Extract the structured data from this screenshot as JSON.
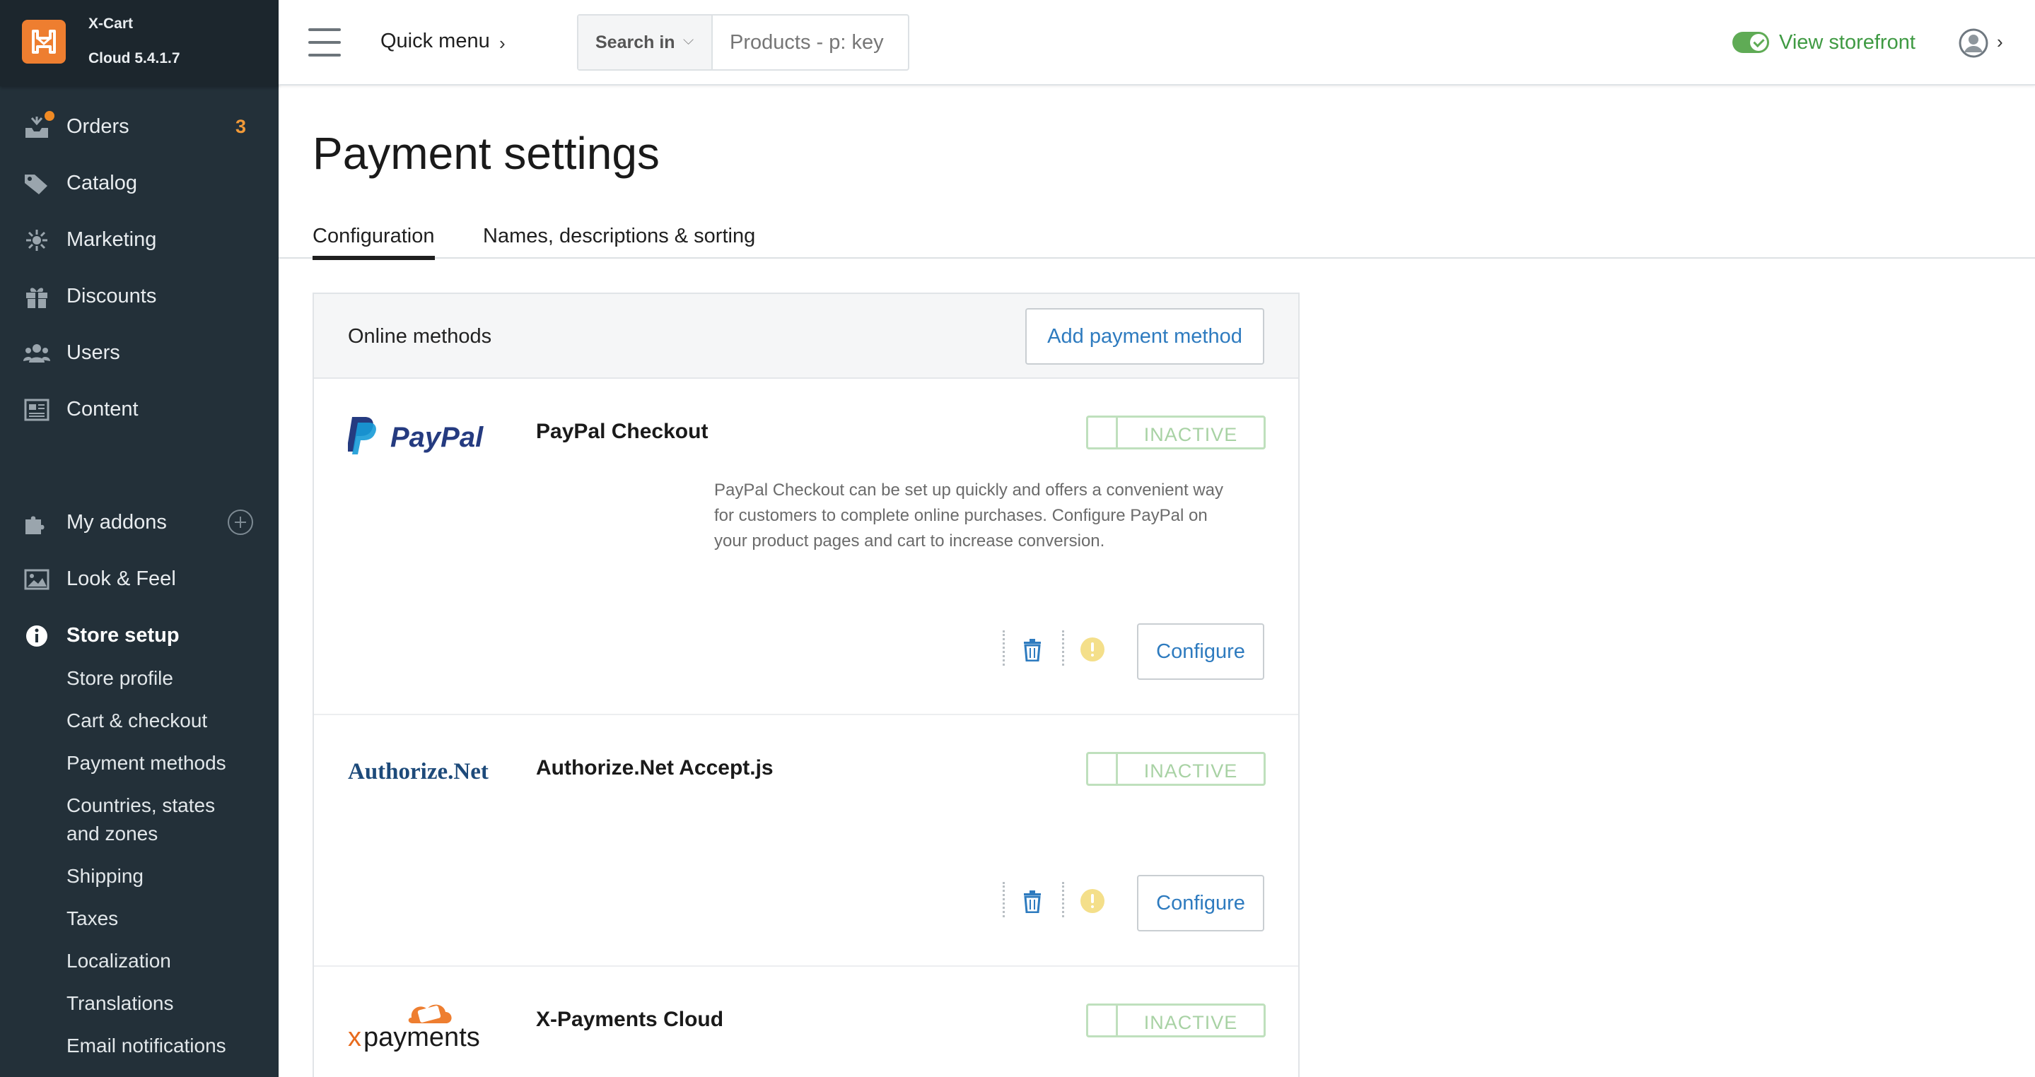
{
  "brand": {
    "name": "X-Cart",
    "version": "Cloud 5.4.1.7"
  },
  "sidebar": {
    "items": [
      {
        "label": "Orders",
        "icon": "orders-icon",
        "badge": "3"
      },
      {
        "label": "Catalog",
        "icon": "tag-icon"
      },
      {
        "label": "Marketing",
        "icon": "marketing-icon"
      },
      {
        "label": "Discounts",
        "icon": "gift-icon"
      },
      {
        "label": "Users",
        "icon": "users-icon"
      },
      {
        "label": "Content",
        "icon": "content-icon"
      },
      {
        "label": "My addons",
        "icon": "puzzle-icon"
      },
      {
        "label": "Look & Feel",
        "icon": "image-icon"
      },
      {
        "label": "Store setup",
        "icon": "info-icon"
      }
    ],
    "store_setup_sub": [
      "Store profile",
      "Cart & checkout",
      "Payment methods",
      "Countries, states",
      "and zones",
      "Shipping",
      "Taxes",
      "Localization",
      "Translations",
      "Email notifications"
    ]
  },
  "topbar": {
    "quick_menu": "Quick menu",
    "chevron": "›",
    "search_in": "Search in",
    "search_placeholder": "Products - p: key",
    "view_storefront": "View storefront"
  },
  "page": {
    "title": "Payment settings",
    "tabs": [
      "Configuration",
      "Names, descriptions & sorting"
    ]
  },
  "panel": {
    "heading": "Online methods",
    "add_button": "Add payment method",
    "methods": [
      {
        "name": "PayPal Checkout",
        "status": "INACTIVE",
        "description": [
          "PayPal Checkout can be set up quickly and offers a convenient way",
          "for customers to complete online purchases. Configure PayPal on",
          "your product pages and cart to increase conversion."
        ],
        "configure": "Configure",
        "logo_text": "PayPal"
      },
      {
        "name": "Authorize.Net Accept.js",
        "status": "INACTIVE",
        "configure": "Configure",
        "logo_text": "Authorize.Net"
      },
      {
        "name": "X-Payments Cloud",
        "status": "INACTIVE",
        "logo_text_x": "x",
        "logo_text_rest": "payments"
      }
    ]
  },
  "colors": {
    "sidebar_bg": "#233039",
    "accent_orange": "#ee7e30",
    "link_blue": "#2e7bbf",
    "storefront_green": "#3f9a43",
    "inactive_green": "#a8d2a4"
  }
}
